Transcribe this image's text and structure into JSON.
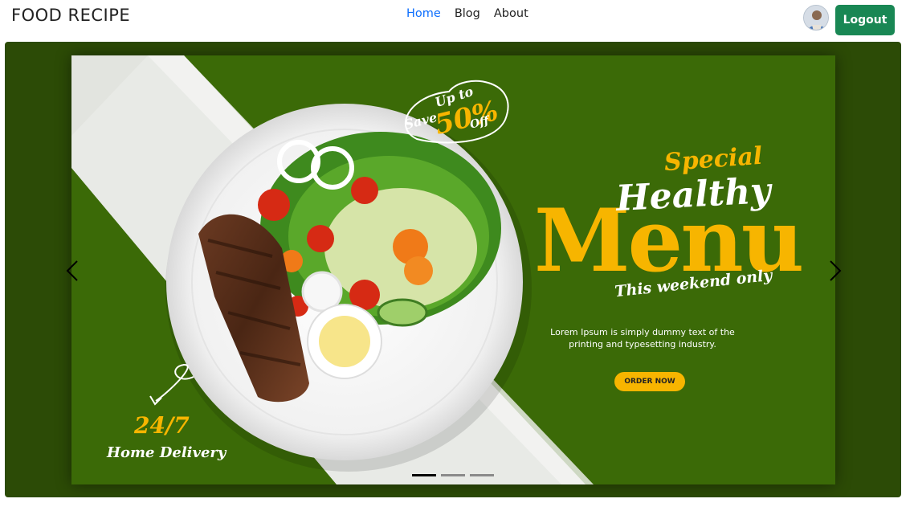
{
  "navbar": {
    "brand": "FOOD RECIPE",
    "links": [
      {
        "label": "Home",
        "active": true
      },
      {
        "label": "Blog",
        "active": false
      },
      {
        "label": "About",
        "active": false
      }
    ],
    "logout_label": "Logout",
    "accent_color": "#0d6efd",
    "logout_color": "#198754"
  },
  "carousel": {
    "slide": {
      "promo_up_to": "Up to",
      "promo_save": "Save",
      "promo_percent": "50%",
      "promo_off": "Off",
      "special": "Special",
      "healthy": "Healthy",
      "menu": "Menu",
      "weekend": "This weekend only",
      "body": "Lorem Ipsum is simply dummy text of the printing and typesetting industry.",
      "cta": "ORDER NOW",
      "delivery_hours": "24/7",
      "delivery_label": "Home Delivery",
      "brand_green": "#3b6a07",
      "brand_yellow": "#f7b500"
    },
    "indicators": 3,
    "active_indicator": 0,
    "icons": [
      "chevron-left-icon",
      "chevron-right-icon"
    ]
  }
}
